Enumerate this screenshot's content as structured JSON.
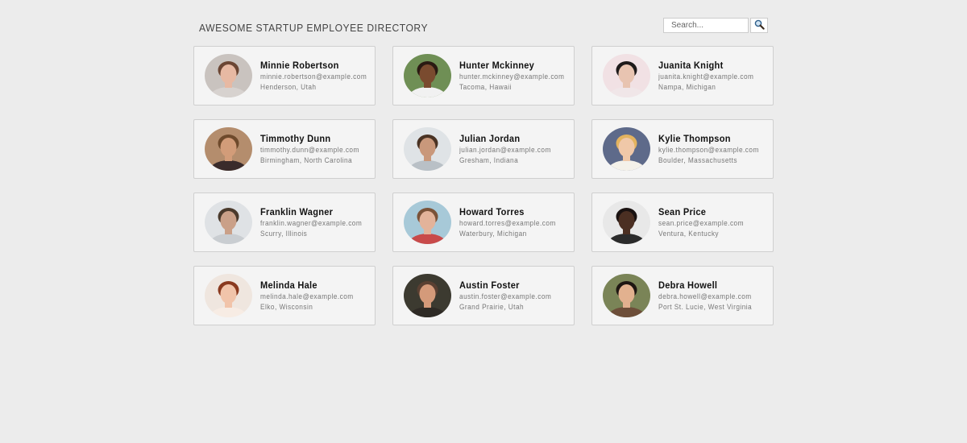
{
  "header": {
    "title": "AWESOME STARTUP EMPLOYEE DIRECTORY",
    "search_placeholder": "Search...",
    "search_icon": "magnifier-icon"
  },
  "employees": [
    {
      "name": "Minnie Robertson",
      "email": "minnie.robertson@example.com",
      "location": "Henderson, Utah",
      "avatar": {
        "bg": "#c9c3bf",
        "skin": "#e7b9a3",
        "hair": "#6b4634",
        "shirt": "#d7d2cf"
      }
    },
    {
      "name": "Hunter Mckinney",
      "email": "hunter.mckinney@example.com",
      "location": "Tacoma, Hawaii",
      "avatar": {
        "bg": "#6f8f55",
        "skin": "#7a4b2f",
        "hair": "#2a1a12",
        "shirt": "#f1f1f1"
      }
    },
    {
      "name": "Juanita Knight",
      "email": "juanita.knight@example.com",
      "location": "Nampa, Michigan",
      "avatar": {
        "bg": "#f1e1e4",
        "skin": "#e8c4b1",
        "hair": "#1e1a1a",
        "shirt": "#f0e6e8"
      }
    },
    {
      "name": "Timmothy Dunn",
      "email": "timmothy.dunn@example.com",
      "location": "Birmingham, North Carolina",
      "avatar": {
        "bg": "#b48d6d",
        "skin": "#d29c79",
        "hair": "#6e4a2c",
        "shirt": "#3a2b2b"
      }
    },
    {
      "name": "Julian Jordan",
      "email": "julian.jordan@example.com",
      "location": "Gresham, Indiana",
      "avatar": {
        "bg": "#dfe3e6",
        "skin": "#c9987b",
        "hair": "#4a3324",
        "shirt": "#b9c0c6"
      }
    },
    {
      "name": "Kylie Thompson",
      "email": "kylie.thompson@example.com",
      "location": "Boulder, Massachusetts",
      "avatar": {
        "bg": "#5e6a8a",
        "skin": "#f0c8a8",
        "hair": "#e3b35f",
        "shirt": "#f4f1ea"
      }
    },
    {
      "name": "Franklin Wagner",
      "email": "franklin.wagner@example.com",
      "location": "Scurry, Illinois",
      "avatar": {
        "bg": "#dfe2e5",
        "skin": "#caa088",
        "hair": "#4a3a2c",
        "shirt": "#c9cdd1"
      }
    },
    {
      "name": "Howard Torres",
      "email": "howard.torres@example.com",
      "location": "Waterbury, Michigan",
      "avatar": {
        "bg": "#a7c9d8",
        "skin": "#e3b39a",
        "hair": "#7a5238",
        "shirt": "#c84a4a"
      }
    },
    {
      "name": "Sean Price",
      "email": "sean.price@example.com",
      "location": "Ventura, Kentucky",
      "avatar": {
        "bg": "#e8e8e8",
        "skin": "#4b2f22",
        "hair": "#1a1211",
        "shirt": "#2b2b2b"
      }
    },
    {
      "name": "Melinda Hale",
      "email": "melinda.hale@example.com",
      "location": "Elko, Wisconsin",
      "avatar": {
        "bg": "#efe6df",
        "skin": "#f1c4aa",
        "hair": "#8a3a1f",
        "shirt": "#f7ece4"
      }
    },
    {
      "name": "Austin Foster",
      "email": "austin.foster@example.com",
      "location": "Grand Prairie, Utah",
      "avatar": {
        "bg": "#3c3a30",
        "skin": "#d49a7a",
        "hair": "#5a4032",
        "shirt": "#2e2a25"
      }
    },
    {
      "name": "Debra Howell",
      "email": "debra.howell@example.com",
      "location": "Port St. Lucie, West Virginia",
      "avatar": {
        "bg": "#7a8457",
        "skin": "#e2b18f",
        "hair": "#1e1612",
        "shirt": "#6d4e39"
      }
    }
  ]
}
